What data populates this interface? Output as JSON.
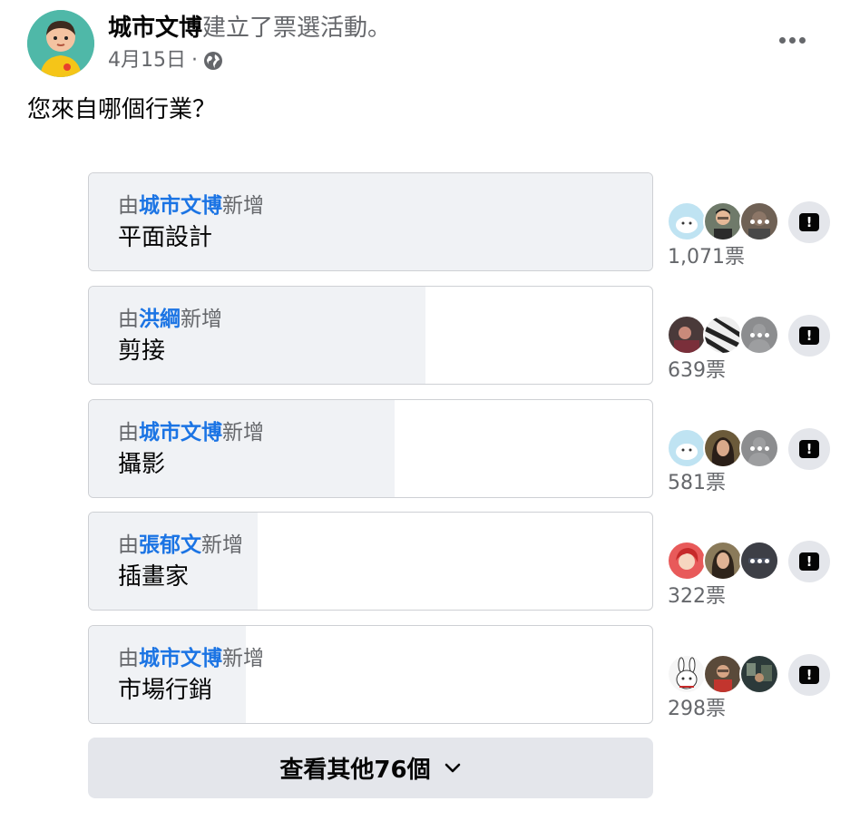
{
  "post": {
    "author": "城市文博",
    "action": "建立了票選活動。",
    "date": "4月15日",
    "separator": "·",
    "privacy_icon": "globe-icon",
    "more_icon": "more-horizontal-icon",
    "question": "您來自哪個行業？"
  },
  "poll": {
    "added_prefix": "由",
    "added_suffix": "新增",
    "vote_suffix": "票",
    "report_icon": "report-icon",
    "options": [
      {
        "adder": "城市文博",
        "label": "平面設計",
        "votes": "1,071",
        "vote_share": 1.0
      },
      {
        "adder": "洪綱",
        "label": "剪接",
        "votes": "639",
        "vote_share": 0.597
      },
      {
        "adder": "城市文博",
        "label": "攝影",
        "votes": "581",
        "vote_share": 0.542
      },
      {
        "adder": "張郁文",
        "label": "插畫家",
        "votes": "322",
        "vote_share": 0.3
      },
      {
        "adder": "城市文博",
        "label": "市場行銷",
        "votes": "298",
        "vote_share": 0.278
      }
    ],
    "see_more_label": "查看其他76個",
    "see_more_icon": "chevron-down-icon"
  },
  "colors": {
    "link_blue": "#1b74e4",
    "secondary_text": "#65676b",
    "fill_gray": "#f0f2f5",
    "button_gray": "#e4e6eb"
  }
}
